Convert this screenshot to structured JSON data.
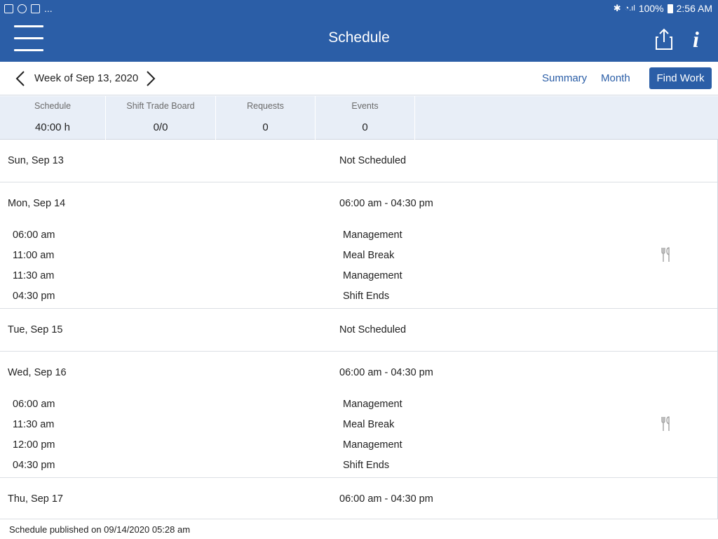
{
  "status_bar": {
    "left_extra": "...",
    "battery": "100%",
    "time": "2:56 AM"
  },
  "header": {
    "title": "Schedule"
  },
  "week_nav": {
    "label": "Week of Sep 13, 2020",
    "summary_link": "Summary",
    "month_link": "Month",
    "find_work": "Find Work"
  },
  "tabs": [
    {
      "label": "Schedule",
      "value": "40:00 h"
    },
    {
      "label": "Shift Trade Board",
      "value": "0/0"
    },
    {
      "label": "Requests",
      "value": "0"
    },
    {
      "label": "Events",
      "value": "0"
    }
  ],
  "days": [
    {
      "name": "Sun, Sep 13",
      "status": "Not Scheduled",
      "segments": []
    },
    {
      "name": "Mon, Sep 14",
      "status": "06:00 am - 04:30 pm",
      "segments": [
        {
          "time": "06:00 am",
          "activity": "Management"
        },
        {
          "time": "11:00 am",
          "activity": "Meal Break"
        },
        {
          "time": "11:30 am",
          "activity": "Management"
        },
        {
          "time": "04:30 pm",
          "activity": "Shift Ends"
        }
      ]
    },
    {
      "name": "Tue, Sep 15",
      "status": "Not Scheduled",
      "segments": []
    },
    {
      "name": "Wed, Sep 16",
      "status": "06:00 am - 04:30 pm",
      "segments": [
        {
          "time": "06:00 am",
          "activity": "Management"
        },
        {
          "time": "11:30 am",
          "activity": "Meal Break"
        },
        {
          "time": "12:00 pm",
          "activity": "Management"
        },
        {
          "time": "04:30 pm",
          "activity": "Shift Ends"
        }
      ]
    },
    {
      "name": "Thu, Sep 17",
      "status": "06:00 am - 04:30 pm",
      "segments": []
    }
  ],
  "footer": {
    "published": "Schedule published on 09/14/2020 05:28 am"
  },
  "colors": {
    "brand": "#2b5ea7",
    "tab_background": "#e8eef7"
  },
  "icons": [
    "menu-icon",
    "share-icon",
    "info-icon",
    "chevron-left-icon",
    "chevron-right-icon",
    "meal-break-icon"
  ]
}
